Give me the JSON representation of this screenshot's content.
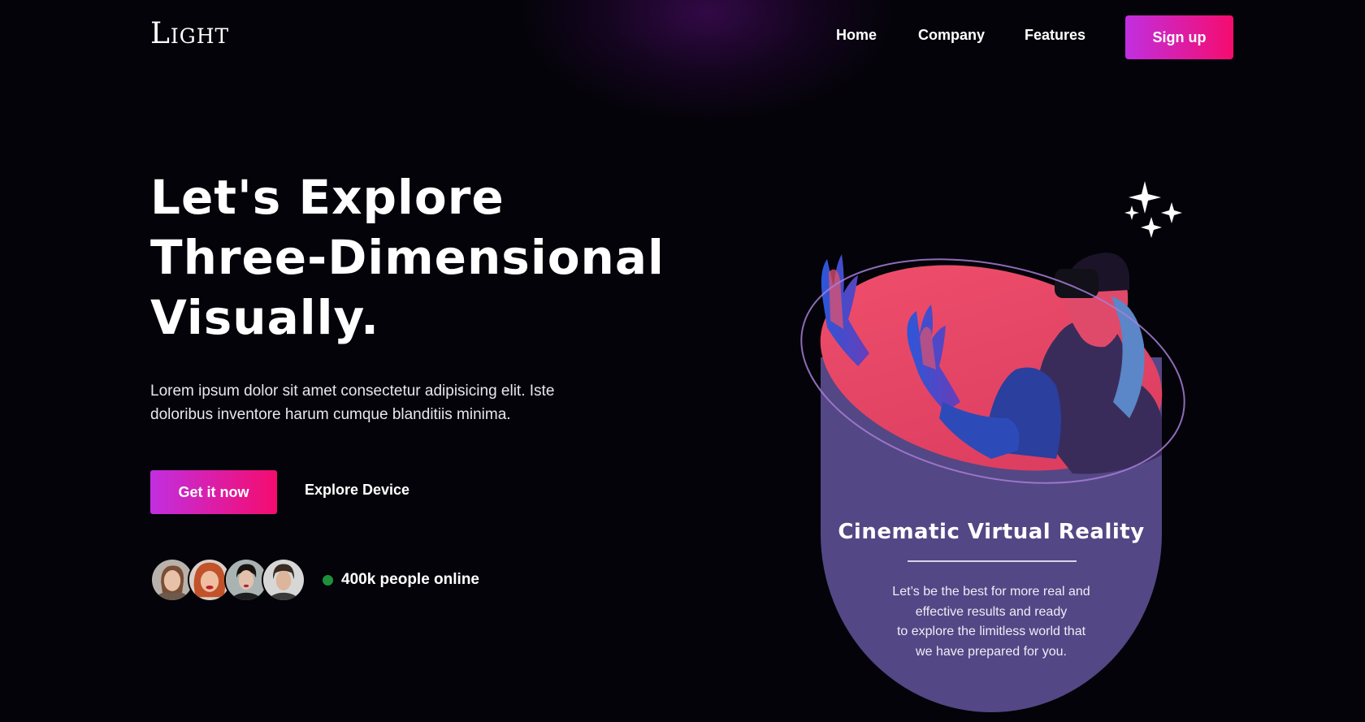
{
  "brand": {
    "logo": "Light"
  },
  "nav": {
    "items": [
      {
        "label": "Home"
      },
      {
        "label": "Company"
      },
      {
        "label": "Features"
      }
    ],
    "signup_label": "Sign up"
  },
  "hero": {
    "title_lines": [
      "Let's Explore",
      "Three-Dimensional",
      "Visually."
    ],
    "description": "Lorem ipsum dolor sit amet consectetur adipisicing elit. Iste doloribus inventore harum cumque blanditiis minima.",
    "primary_cta": "Get it now",
    "secondary_cta": "Explore Device",
    "online_text": "400k people online"
  },
  "card": {
    "title": "Cinematic Virtual Reality",
    "text_lines": [
      "Let’s be the best for more real and",
      "effective results and ready",
      "to explore the limitless world that",
      "we have prepared for you."
    ]
  },
  "colors": {
    "background": "#040309",
    "gradient_start": "#c12fe0",
    "gradient_end": "#f50c6e",
    "card_purple": "#544785",
    "card_pink": "#ea4365",
    "online_green": "#1f8f3a"
  },
  "icons": [
    "sparkle-icon",
    "status-dot-icon"
  ]
}
